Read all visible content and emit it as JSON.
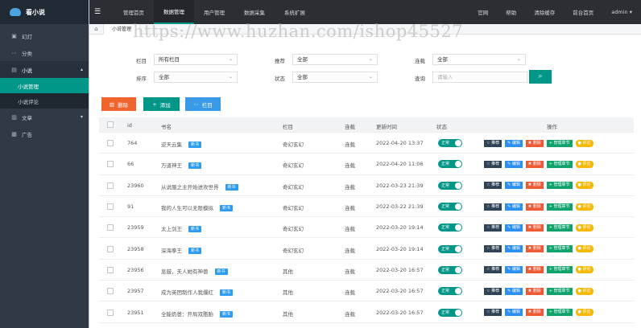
{
  "app": {
    "name": "看小说"
  },
  "topbar": {
    "tabs": [
      "管理首页",
      "数据管理",
      "用户管理",
      "数据采集",
      "系统扩展"
    ],
    "active_tab": 1,
    "right": [
      "官网",
      "帮助",
      "清除缓存",
      "前台首页",
      "admin ▾"
    ]
  },
  "sidebar": {
    "items": [
      {
        "icon": "▣",
        "label": "幻灯"
      },
      {
        "icon": "⋯",
        "label": "分类"
      },
      {
        "icon": "▤",
        "label": "小说",
        "caret": "▴",
        "open": true
      },
      {
        "icon": "▥",
        "label": "文章",
        "caret": "▾"
      },
      {
        "icon": "▦",
        "label": "广告"
      }
    ],
    "sub_items": [
      "小说管理",
      "小说评论"
    ]
  },
  "breadcrumb": {
    "home_icon": "⌂",
    "current": "小说管理"
  },
  "watermark": "https://www.huzhan.com/ishop45527",
  "filter": {
    "column_label": "栏目",
    "column_value": "所有栏目",
    "sort_label": "排序",
    "sort_value": "全部",
    "recommend_label": "推荐",
    "recommend_value": "全部",
    "status_label": "状态",
    "status_value": "全部",
    "serial_label": "连载",
    "serial_value": "全部",
    "query_label": "查询",
    "query_placeholder": "请输入",
    "search_icon": "⌕"
  },
  "actions": {
    "delete": "删除",
    "add": "添加",
    "column": "栏目"
  },
  "table": {
    "headers": [
      "id",
      "书名",
      "栏目",
      "连载",
      "更新时间",
      "状态",
      "操作"
    ],
    "new_tag": "新书",
    "status_label": "正常",
    "op_labels": [
      "推荐",
      "编辑",
      "删除",
      "管理章节",
      "评论"
    ],
    "rows": [
      {
        "id": "764",
        "title": "逆天云集",
        "column": "奇幻玄幻",
        "serial": "连载",
        "time": "2022-04-20 13:37"
      },
      {
        "id": "66",
        "title": "万道神王",
        "column": "奇幻玄幻",
        "serial": "连载",
        "time": "2022-04-20 11:06"
      },
      {
        "id": "23960",
        "title": "从说服之主开始进攻世界",
        "column": "奇幻玄幻",
        "serial": "连载",
        "time": "2022-03-23 21:39"
      },
      {
        "id": "91",
        "title": "我的人生可以无限模拟",
        "column": "奇幻玄幻",
        "serial": "连载",
        "time": "2022-03-22 21:39"
      },
      {
        "id": "23959",
        "title": "太上剑王",
        "column": "奇幻玄幻",
        "serial": "连载",
        "time": "2022-03-20 19:14"
      },
      {
        "id": "23958",
        "title": "深海拳王",
        "column": "奇幻玄幻",
        "serial": "连载",
        "time": "2022-03-20 19:14"
      },
      {
        "id": "23956",
        "title": "息鼓，夫人她有神兽",
        "column": "其他",
        "serial": "连载",
        "time": "2022-03-20 16:57"
      },
      {
        "id": "23957",
        "title": "成为英团制作人我爆红",
        "column": "其他",
        "serial": "连载",
        "time": "2022-03-20 16:57"
      },
      {
        "id": "23951",
        "title": "全能奶爸：开局双胞胎",
        "column": "其他",
        "serial": "连载",
        "time": "2022-03-20 16:57"
      }
    ]
  }
}
